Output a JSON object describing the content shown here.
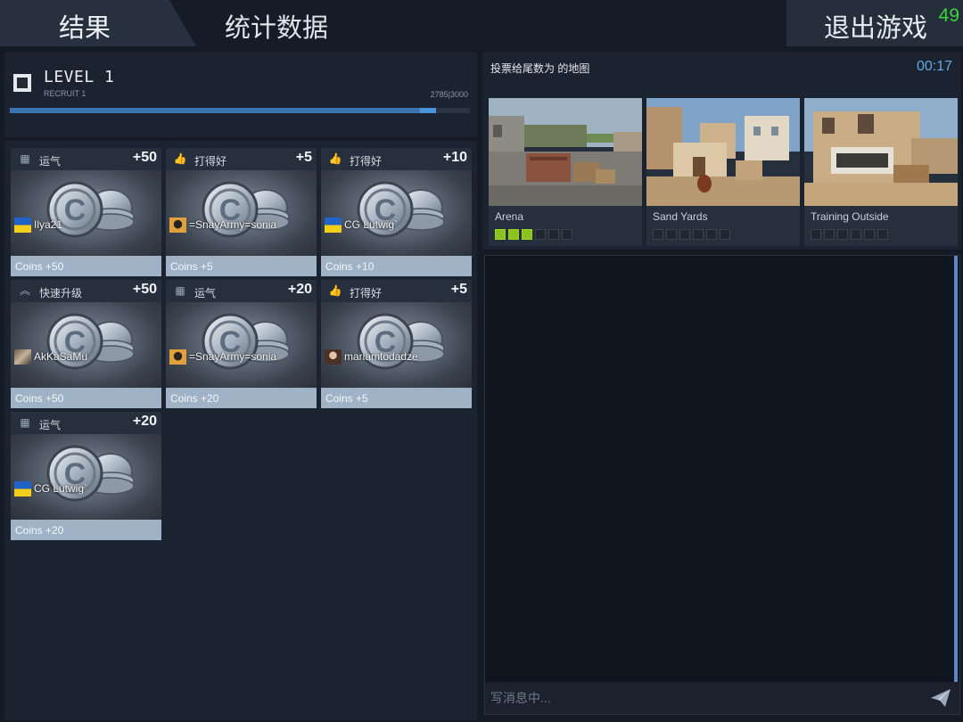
{
  "topbar": {
    "tab_results": "结果",
    "tab_stats": "统计数据",
    "exit_label": "退出游戏",
    "exit_countdown": "49"
  },
  "level": {
    "title": "LEVEL 1",
    "rank": "RECRUIT 1",
    "xp_text": "2785|3000",
    "xp_current": 2785,
    "xp_max": 3000
  },
  "rewards": [
    {
      "reason": "运气",
      "icon": "luck-icon",
      "bonus": "+50",
      "player": "Ilya21",
      "avatar": "flag-ukraine",
      "coins": "Coins +50"
    },
    {
      "reason": "打得好",
      "icon": "thumbs-up-icon",
      "bonus": "+5",
      "player": "=SnayArmy=sonia",
      "avatar": "avatar-masked",
      "coins": "Coins +5"
    },
    {
      "reason": "打得好",
      "icon": "thumbs-up-icon",
      "bonus": "+10",
      "player": "CG Lutwig`",
      "avatar": "flag-ukraine",
      "coins": "Coins +10"
    },
    {
      "reason": "快速升级",
      "icon": "rank-up-icon",
      "bonus": "+50",
      "player": "AkKaSaMu",
      "avatar": "avatar-photo",
      "coins": "Coins +50"
    },
    {
      "reason": "运气",
      "icon": "luck-icon",
      "bonus": "+20",
      "player": "=SnayArmy=sonia",
      "avatar": "avatar-masked",
      "coins": "Coins +20"
    },
    {
      "reason": "打得好",
      "icon": "thumbs-up-icon",
      "bonus": "+5",
      "player": "mariamtodadze",
      "avatar": "avatar-woman",
      "coins": "Coins +5"
    },
    {
      "reason": "运气",
      "icon": "luck-icon",
      "bonus": "+20",
      "player": "CG Lutwig`",
      "avatar": "flag-ukraine",
      "coins": "Coins +20"
    }
  ],
  "vote": {
    "title": "投票给尾数为 的地图",
    "timer": "00:17",
    "maps": [
      {
        "name": "Arena",
        "votes": 3,
        "max_votes": 6
      },
      {
        "name": "Sand Yards",
        "votes": 0,
        "max_votes": 6
      },
      {
        "name": "Training Outside",
        "votes": 0,
        "max_votes": 6
      }
    ]
  },
  "chat": {
    "placeholder": "写消息中..."
  },
  "colors": {
    "accent_blue": "#64a8e6",
    "countdown_green": "#39d43c",
    "vote_green": "#8cc21d",
    "coin_footer": "#9fb2c6"
  }
}
